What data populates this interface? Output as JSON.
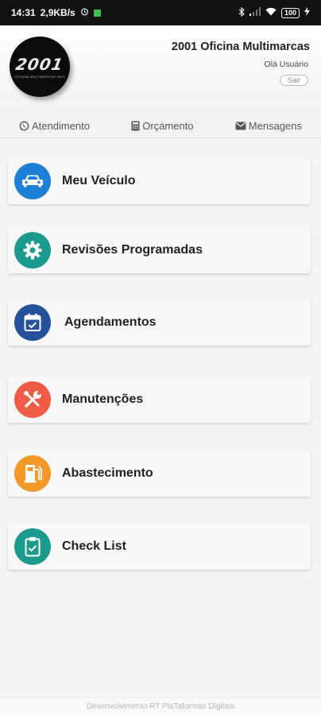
{
  "status_bar": {
    "time": "14:31",
    "speed": "2,9KB/s",
    "battery": "100"
  },
  "header": {
    "logo_text": "2001",
    "logo_subtext": "OFICINA MULTIMARCAS 2001",
    "shop_name": "2001 Oficina Multimarcas",
    "greeting": "Olá Usuário",
    "logout_label": "Sair"
  },
  "tabs": [
    {
      "label": "Atendimento",
      "icon": "whatsapp-icon"
    },
    {
      "label": "Orçamento",
      "icon": "calculator-icon"
    },
    {
      "label": "Mensagens",
      "icon": "envelope-icon"
    }
  ],
  "menu": [
    {
      "label": "Meu Veículo",
      "icon": "car-icon",
      "color": "#1e7fd6"
    },
    {
      "label": "Revisões Programadas",
      "icon": "gear-icon",
      "color": "#1c9a8e"
    },
    {
      "label": "Agendamentos",
      "icon": "calendar-check-icon",
      "color": "#25519a"
    },
    {
      "label": "Manutenções",
      "icon": "tools-icon",
      "color": "#ef5b45"
    },
    {
      "label": "Abastecimento",
      "icon": "fuel-pump-icon",
      "color": "#f2992a"
    },
    {
      "label": "Check List",
      "icon": "clipboard-check-icon",
      "color": "#1c9a8e"
    }
  ],
  "footer": {
    "text": "Desenvolvimento RT PlaTaformas Digitais"
  }
}
